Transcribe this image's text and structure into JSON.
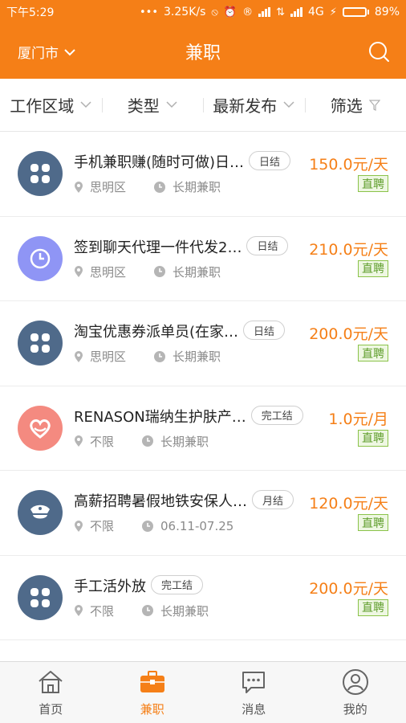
{
  "status_bar": {
    "time": "下午5:29",
    "network_speed": "3.25K/s",
    "network_type": "4G",
    "battery": "89%",
    "battery_level": 0.89
  },
  "header": {
    "city": "厦门市",
    "title": "兼职"
  },
  "filters": [
    {
      "label": "工作区域"
    },
    {
      "label": "类型"
    },
    {
      "label": "最新发布"
    },
    {
      "label": "筛选"
    }
  ],
  "jobs": [
    {
      "title": "手机兼职赚(随时可做)日…",
      "settle": "日结",
      "salary": "150.0元/天",
      "badge": "直聘",
      "location": "思明区",
      "duration": "长期兼职",
      "icon": "grid-icon",
      "color": "#4f6a8a"
    },
    {
      "title": "签到聊天代理一件代发2…",
      "settle": "日结",
      "salary": "210.0元/天",
      "badge": "直聘",
      "location": "思明区",
      "duration": "长期兼职",
      "icon": "clock-icon",
      "color": "#8f95f5"
    },
    {
      "title": "淘宝优惠券派单员(在家…",
      "settle": "日结",
      "salary": "200.0元/天",
      "badge": "直聘",
      "location": "思明区",
      "duration": "长期兼职",
      "icon": "grid-icon",
      "color": "#4f6a8a"
    },
    {
      "title": "RENASON瑞纳生护肤产…",
      "settle": "完工结",
      "salary": "1.0元/月",
      "badge": "直聘",
      "location": "不限",
      "duration": "长期兼职",
      "icon": "heart-icon",
      "color": "#f48a80"
    },
    {
      "title": "高薪招聘暑假地铁安保人…",
      "settle": "月结",
      "salary": "120.0元/天",
      "badge": "直聘",
      "location": "不限",
      "duration": "06.11-07.25",
      "icon": "police-cap-icon",
      "color": "#4f6a8a"
    },
    {
      "title": "手工活外放",
      "settle": "完工结",
      "salary": "200.0元/天",
      "badge": "直聘",
      "location": "不限",
      "duration": "长期兼职",
      "icon": "grid-icon",
      "color": "#4f6a8a"
    }
  ],
  "nav": [
    {
      "label": "首页",
      "icon": "home-icon"
    },
    {
      "label": "兼职",
      "icon": "briefcase-icon"
    },
    {
      "label": "消息",
      "icon": "chat-icon"
    },
    {
      "label": "我的",
      "icon": "user-icon"
    }
  ],
  "colors": {
    "accent": "#f57f17",
    "salary": "#f57f17",
    "badge_green": "#5f9e2c"
  }
}
